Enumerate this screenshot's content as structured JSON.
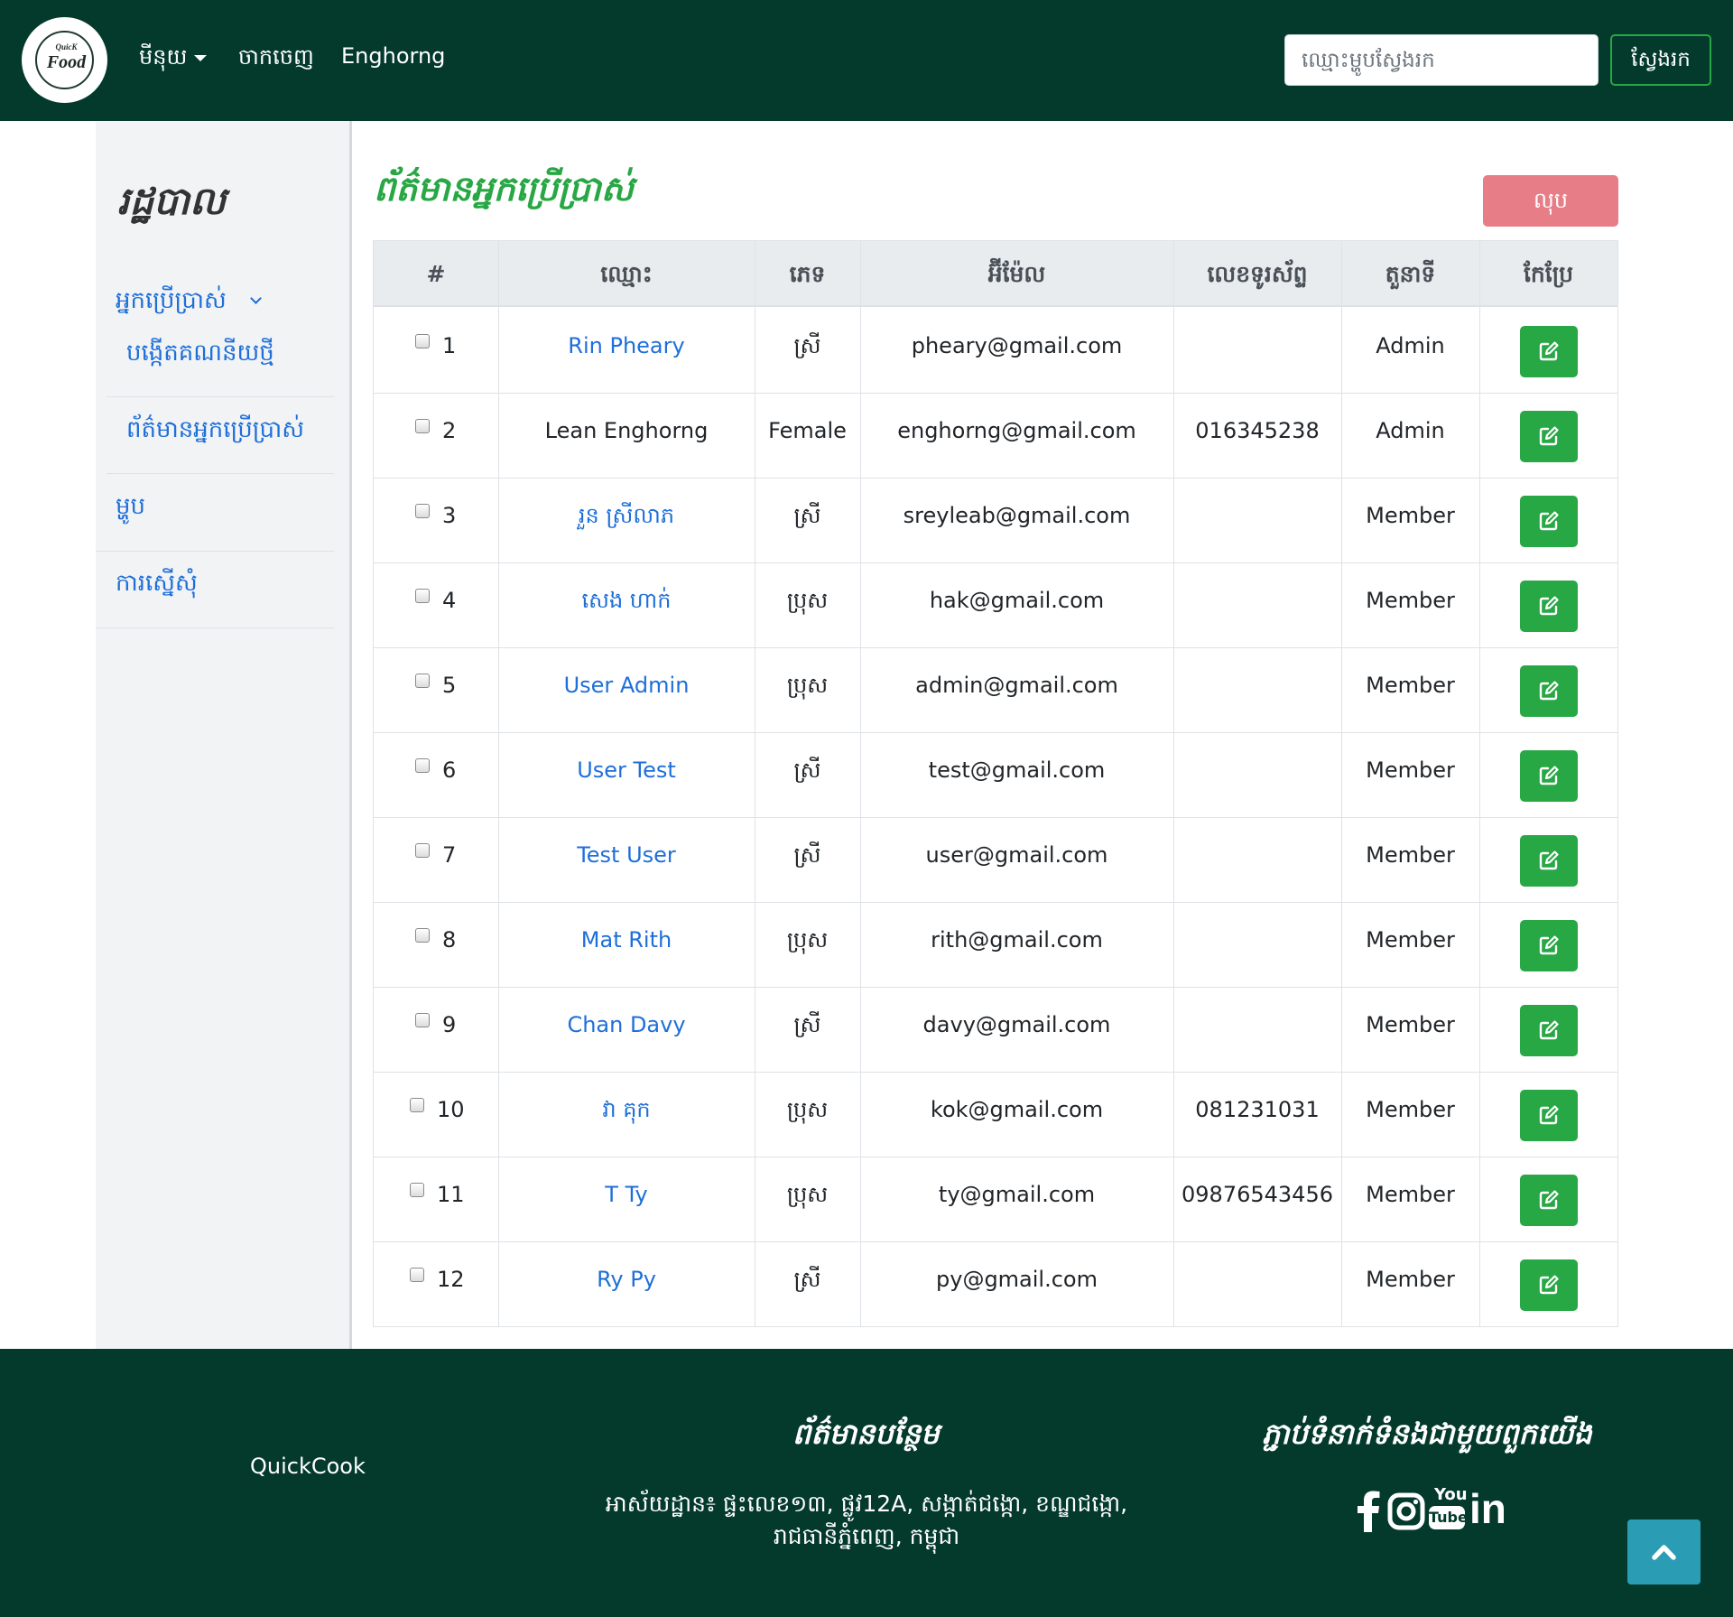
{
  "navbar": {
    "logo_small": "QuicK",
    "logo_big": "Food",
    "menu_label": "មីនុយ",
    "logout_label": "ចាកចេញ",
    "username": "Enghorng",
    "search_placeholder": "ឈ្មោះម្ហូបស្វែងរក",
    "search_button": "ស្វែងរក"
  },
  "sidebar": {
    "title": "រដ្ឋបាល",
    "users_label": "អ្នកប្រើប្រាស់",
    "create_account": "បង្កើតគណនីយថ្មី",
    "user_info": "ព័ត៌មានអ្នកប្រើប្រាស់",
    "food": "ម្ហូប",
    "requests": "ការស្នើសុំ"
  },
  "main": {
    "title": "ព័ត៌មានអ្នកប្រើប្រាស់",
    "delete_button": "លុប",
    "columns": [
      "#",
      "ឈ្មោះ",
      "ភេទ",
      "អ៊ីម៉ែល",
      "លេខទូរស័ព្ទ",
      "តួនាទី",
      "កែប្រែ"
    ],
    "rows": [
      {
        "no": "1",
        "name": "Rin Pheary",
        "link": true,
        "gender": "ស្រី",
        "email": "pheary@gmail.com",
        "phone": "",
        "role": "Admin"
      },
      {
        "no": "2",
        "name": "Lean Enghorng",
        "link": false,
        "gender": "Female",
        "email": "enghorng@gmail.com",
        "phone": "016345238",
        "role": "Admin"
      },
      {
        "no": "3",
        "name": "រួន ស្រីលាភ",
        "link": true,
        "gender": "ស្រី",
        "email": "sreyleab@gmail.com",
        "phone": "",
        "role": "Member"
      },
      {
        "no": "4",
        "name": "សេង ហាក់",
        "link": true,
        "gender": "ប្រុស",
        "email": "hak@gmail.com",
        "phone": "",
        "role": "Member"
      },
      {
        "no": "5",
        "name": "User Admin",
        "link": true,
        "gender": "ប្រុស",
        "email": "admin@gmail.com",
        "phone": "",
        "role": "Member"
      },
      {
        "no": "6",
        "name": "User Test",
        "link": true,
        "gender": "ស្រី",
        "email": "test@gmail.com",
        "phone": "",
        "role": "Member"
      },
      {
        "no": "7",
        "name": "Test User",
        "link": true,
        "gender": "ស្រី",
        "email": "user@gmail.com",
        "phone": "",
        "role": "Member"
      },
      {
        "no": "8",
        "name": "Mat Rith",
        "link": true,
        "gender": "ប្រុស",
        "email": "rith@gmail.com",
        "phone": "",
        "role": "Member"
      },
      {
        "no": "9",
        "name": "Chan Davy",
        "link": true,
        "gender": "ស្រី",
        "email": "davy@gmail.com",
        "phone": "",
        "role": "Member"
      },
      {
        "no": "10",
        "name": "វា គុក",
        "link": true,
        "gender": "ប្រុស",
        "email": "kok@gmail.com",
        "phone": "081231031",
        "role": "Member"
      },
      {
        "no": "11",
        "name": "T Ty",
        "link": true,
        "gender": "ប្រុស",
        "email": "ty@gmail.com",
        "phone": "09876543456",
        "role": "Member"
      },
      {
        "no": "12",
        "name": "Ry Py",
        "link": true,
        "gender": "ស្រី",
        "email": "py@gmail.com",
        "phone": "",
        "role": "Member"
      }
    ]
  },
  "footer": {
    "brand": "QuickCook",
    "more_info_title": "ព័ត៌មានបន្ថែម",
    "address_line1": "អាស័យដ្ឋាន៖ ផ្ទះលេខ១៣, ផ្លូវ12A, សង្កាត់ជង្កោ, ខណ្ឌជង្កោ,",
    "address_line2": "រាជធានីភ្នំពេញ, កម្ពុជា",
    "contact_title": "ភ្ជាប់ទំនាក់ទំនងជាមួយពួកយើង",
    "youtube_top": "You",
    "youtube_bottom": "Tube",
    "linkedin": "in"
  },
  "colors": {
    "navbar_bg": "#033a2b",
    "accent_green": "#28a745",
    "link_blue": "#1e6fd9",
    "delete_pink": "#e77d87",
    "to_top_blue": "#2a9db5"
  },
  "icons": [
    "caret-down-icon",
    "chevron-down-icon",
    "edit-icon",
    "facebook-icon",
    "instagram-icon",
    "youtube-icon",
    "linkedin-icon",
    "arrow-up-icon"
  ]
}
